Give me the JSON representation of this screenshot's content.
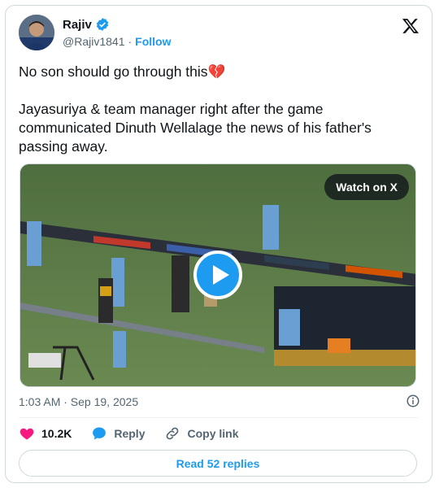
{
  "author": {
    "name": "Rajiv",
    "handle": "@Rajiv1841",
    "separator": "·",
    "follow_label": "Follow"
  },
  "tweet": {
    "line1": "No son should go through this💔",
    "line2": "Jayasuriya & team manager right after the game communicated Dinuth Wellalage the news of his father's passing away."
  },
  "media": {
    "watch_label": "Watch on X"
  },
  "meta": {
    "timestamp": "1:03 AM · Sep 19, 2025"
  },
  "actions": {
    "likes": "10.2K",
    "reply_label": "Reply",
    "copy_label": "Copy link"
  },
  "read_replies_label": "Read 52 replies",
  "colors": {
    "accent": "#1d9bf0",
    "like": "#f91880",
    "text": "#0f1419",
    "secondary": "#536471",
    "border": "#cfd9de"
  },
  "icons": {
    "verified": "verified-badge-icon",
    "platform": "x-logo-icon",
    "info": "info-icon",
    "like": "heart-icon",
    "reply": "speech-bubble-icon",
    "copy": "link-icon",
    "play": "play-icon"
  }
}
